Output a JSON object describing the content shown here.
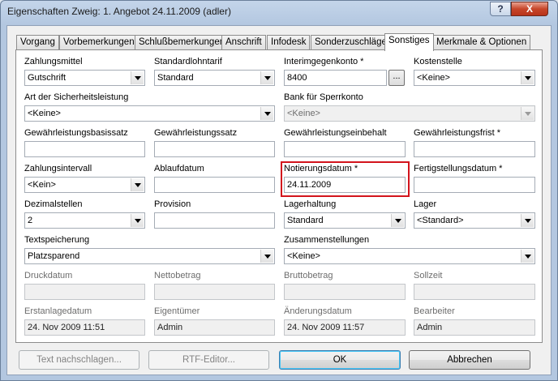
{
  "window": {
    "title": "Eigenschaften Zweig: 1. Angebot 24.11.2009 (adler)",
    "help_label": "?",
    "close_label": "X"
  },
  "tabs": [
    {
      "label": "Vorgang",
      "active": false
    },
    {
      "label": "Vorbemerkungen",
      "active": false
    },
    {
      "label": "Schlußbemerkungen",
      "active": false
    },
    {
      "label": "Anschrift",
      "active": false
    },
    {
      "label": "Infodesk",
      "active": false
    },
    {
      "label": "Sonderzuschläge",
      "active": false
    },
    {
      "label": "Sonstiges",
      "active": true
    },
    {
      "label": "Merkmale & Optionen",
      "active": false
    }
  ],
  "form": {
    "zahlungsmittel": {
      "label": "Zahlungsmittel",
      "value": "Gutschrift"
    },
    "standardlohntarif": {
      "label": "Standardlohntarif",
      "value": "Standard"
    },
    "interimgegenkonto": {
      "label": "Interimgegenkonto *",
      "value": "8400",
      "browse_label": "..."
    },
    "kostenstelle": {
      "label": "Kostenstelle",
      "value": "<Keine>"
    },
    "sicherheitsleistung": {
      "label": "Art der Sicherheitsleistung",
      "value": "<Keine>"
    },
    "sperrkonto": {
      "label": "Bank für Sperrkonto",
      "value": "<Keine>"
    },
    "gewaehrleistungsbasissatz": {
      "label": "Gewährleistungsbasissatz",
      "value": ""
    },
    "gewaehrleistungssatz": {
      "label": "Gewährleistungssatz",
      "value": ""
    },
    "gewaehrleistungseinbehalt": {
      "label": "Gewährleistungseinbehalt",
      "value": ""
    },
    "gewaehrleistungsfrist": {
      "label": "Gewährleistungsfrist *",
      "value": ""
    },
    "zahlungsintervall": {
      "label": "Zahlungsintervall",
      "value": "<Kein>"
    },
    "ablaufdatum": {
      "label": "Ablaufdatum",
      "value": ""
    },
    "notierungsdatum": {
      "label": "Notierungsdatum *",
      "value": "24.11.2009"
    },
    "fertigstellungsdatum": {
      "label": "Fertigstellungsdatum *",
      "value": ""
    },
    "dezimalstellen": {
      "label": "Dezimalstellen",
      "value": "2"
    },
    "provision": {
      "label": "Provision",
      "value": ""
    },
    "lagerhaltung": {
      "label": "Lagerhaltung",
      "value": "Standard"
    },
    "lager": {
      "label": "Lager",
      "value": "<Standard>"
    },
    "textspeicherung": {
      "label": "Textspeicherung",
      "value": "Platzsparend"
    },
    "zusammenstellungen": {
      "label": "Zusammenstellungen",
      "value": "<Keine>"
    },
    "druckdatum": {
      "label": "Druckdatum",
      "value": ""
    },
    "nettobetrag": {
      "label": "Nettobetrag",
      "value": ""
    },
    "bruttobetrag": {
      "label": "Bruttobetrag",
      "value": ""
    },
    "sollzeit": {
      "label": "Sollzeit",
      "value": ""
    },
    "erstanlagedatum": {
      "label": "Erstanlagedatum",
      "value": "24. Nov 2009 11:51"
    },
    "eigentuemer": {
      "label": "Eigentümer",
      "value": "Admin"
    },
    "aenderungsdatum": {
      "label": "Änderungsdatum",
      "value": "24. Nov 2009 11:57"
    },
    "bearbeiter": {
      "label": "Bearbeiter",
      "value": "Admin"
    }
  },
  "buttons": {
    "text_nachschlagen": "Text nachschlagen...",
    "rtf_editor": "RTF-Editor...",
    "ok": "OK",
    "abbrechen": "Abbrechen"
  },
  "colors": {
    "highlight": "#d3141c",
    "titlebar": "#b3c7e0",
    "close_button": "#c7462a"
  }
}
